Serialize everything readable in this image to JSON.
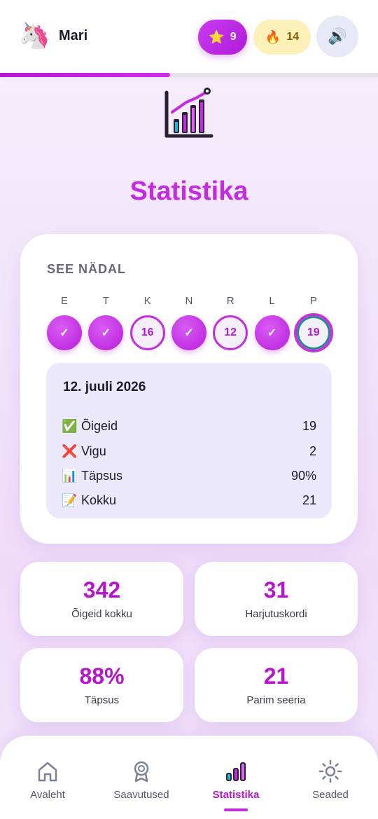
{
  "header": {
    "avatar_emoji": "🦄",
    "user_name": "Mari",
    "stars": {
      "icon": "⭐",
      "count": "9"
    },
    "streak": {
      "icon": "🔥",
      "count": "14"
    },
    "sound_icon": "🔊",
    "progress_fraction": 0.45
  },
  "page": {
    "title": "Statistika",
    "hero_icon": "bar-chart-rising-icon"
  },
  "week": {
    "label": "SEE NÄDAL",
    "days": [
      {
        "letter": "E",
        "mark": "✓",
        "state": "done"
      },
      {
        "letter": "T",
        "mark": "✓",
        "state": "done"
      },
      {
        "letter": "K",
        "mark": "16",
        "state": "open"
      },
      {
        "letter": "N",
        "mark": "✓",
        "state": "done"
      },
      {
        "letter": "R",
        "mark": "12",
        "state": "open"
      },
      {
        "letter": "L",
        "mark": "✓",
        "state": "done"
      },
      {
        "letter": "P",
        "mark": "19",
        "state": "today"
      }
    ],
    "detail": {
      "date": "12. juuli 2026",
      "rows": [
        {
          "emoji": "✅",
          "label": "Õigeid",
          "value": "19"
        },
        {
          "emoji": "❌",
          "label": "Vigu",
          "value": "2"
        },
        {
          "emoji": "📊",
          "label": "Täpsus",
          "value": "90%"
        },
        {
          "emoji": "📝",
          "label": "Kokku",
          "value": "21"
        }
      ]
    }
  },
  "stats": [
    {
      "value": "342",
      "label": "Õigeid kokku"
    },
    {
      "value": "31",
      "label": "Harjutuskordi"
    },
    {
      "value": "88%",
      "label": "Täpsus"
    },
    {
      "value": "21",
      "label": "Parim seeria"
    }
  ],
  "nav": {
    "items": [
      {
        "label": "Avaleht",
        "icon": "home-icon"
      },
      {
        "label": "Saavutused",
        "icon": "award-icon"
      },
      {
        "label": "Statistika",
        "icon": "bar-chart-icon"
      },
      {
        "label": "Seaded",
        "icon": "sun-gear-icon"
      }
    ],
    "active_index": 2
  },
  "colors": {
    "accent": "#c42ae0",
    "accent_dark": "#b814d0",
    "streak_bg": "#fdf0b8",
    "detail_bg": "#ebe9fb"
  }
}
